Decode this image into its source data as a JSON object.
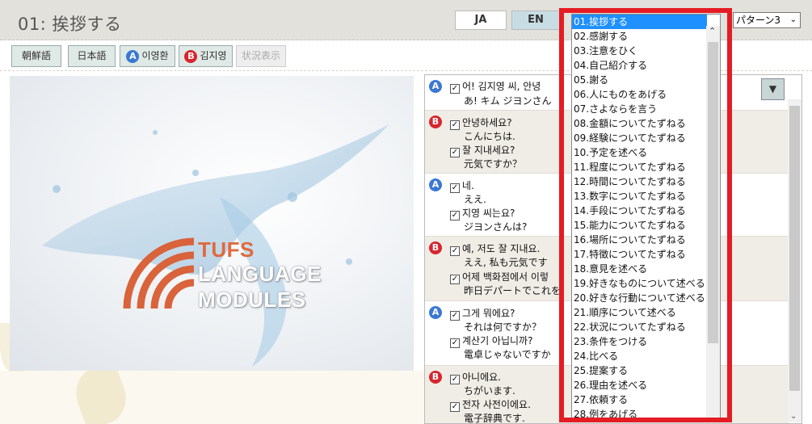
{
  "header": {
    "title": "01: 挨拶する",
    "lang_ja": "JA",
    "lang_en": "EN",
    "pattern_select": "パターン3"
  },
  "toolbar": {
    "korean": "朝鮮語",
    "japanese": "日本語",
    "speaker_a_badge": "A",
    "speaker_a": "이영환",
    "speaker_b_badge": "B",
    "speaker_b": "김지영",
    "status": "状況表示"
  },
  "logo": {
    "line1": "TUFS",
    "line2": "LANGUAGE",
    "line3": "MODULES"
  },
  "dialog": {
    "check_mark": "✓",
    "dropdown_arrow": "▼",
    "entries": [
      {
        "speaker": "A",
        "lines": [
          {
            "ko": "어! 김지영 씨, 안녕",
            "ja": "あ! キム ジヨンさん"
          }
        ]
      },
      {
        "speaker": "B",
        "lines": [
          {
            "ko": "안녕하세요?",
            "ja": "こんにちは."
          },
          {
            "ko": "잘 지내세요?",
            "ja": "元気ですか？"
          }
        ]
      },
      {
        "speaker": "A",
        "lines": [
          {
            "ko": "네.",
            "ja": "ええ."
          },
          {
            "ko": "지영 씨는요?",
            "ja": "ジヨンさんは?"
          }
        ]
      },
      {
        "speaker": "B",
        "lines": [
          {
            "ko": "예, 저도 잘 지내요.",
            "ja": "ええ, 私も元気です"
          },
          {
            "ko": "어제 백화점에서 이렇",
            "ja": "昨日デパートでこれを"
          }
        ]
      },
      {
        "speaker": "A",
        "lines": [
          {
            "ko": "그게 뭐에요?",
            "ja": "それは何ですか？"
          },
          {
            "ko": "계산기 아닙니까?",
            "ja": "電卓じゃないですか"
          }
        ]
      },
      {
        "speaker": "B",
        "lines": [
          {
            "ko": "아니에요.",
            "ja": "ちがいます."
          },
          {
            "ko": "전자 사전이에요.",
            "ja": "電子辞典です."
          }
        ]
      }
    ]
  },
  "topic_list": {
    "selected_index": 0,
    "items": [
      "01.挨拶する",
      "02.感謝する",
      "03.注意をひく",
      "04.自己紹介する",
      "05.謝る",
      "06.人にものをあげる",
      "07.さよならを言う",
      "08.金額についてたずねる",
      "09.経験についてたずねる",
      "10.予定を述べる",
      "11.程度についてたずねる",
      "12.時間についてたずねる",
      "13.数字についてたずねる",
      "14.手段についてたずねる",
      "15.能力についてたずねる",
      "16.場所についてたずねる",
      "17.特徴についてたずねる",
      "18.意見を述べる",
      "19.好きなものについて述べる",
      "20.好きな行動について述べる",
      "21.順序について述べる",
      "22.状況についてたずねる",
      "23.条件をつける",
      "24.比べる",
      "25.提案する",
      "26.理由を述べる",
      "27.依頼する",
      "28.例をあげる"
    ]
  },
  "colors": {
    "highlight_frame": "#e51c24",
    "selection": "#1e90ff",
    "badge_a": "#3b78d4",
    "badge_b": "#d7262e"
  }
}
